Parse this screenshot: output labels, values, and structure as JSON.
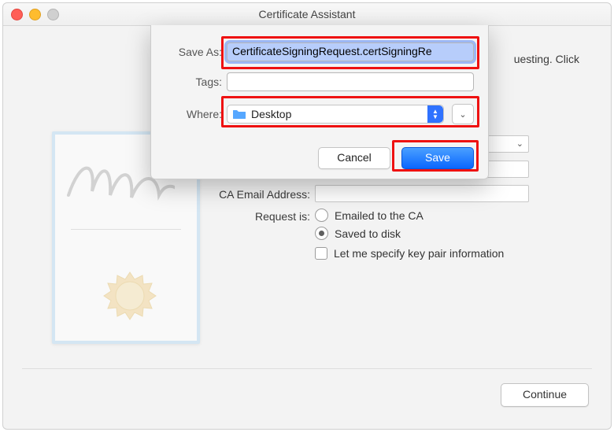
{
  "window": {
    "title": "Certificate Assistant"
  },
  "background": {
    "truncated_text": "uesting. Click",
    "ca_email_label": "CA Email Address:",
    "request_is_label": "Request is:",
    "radio_emailed": "Emailed to the CA",
    "radio_saved": "Saved to disk",
    "check_keypair": "Let me specify key pair information",
    "continue_label": "Continue"
  },
  "sheet": {
    "save_as_label": "Save As:",
    "save_as_value": "CertificateSigningRequest.certSigningRe",
    "tags_label": "Tags:",
    "tags_value": "",
    "where_label": "Where:",
    "where_value": "Desktop",
    "cancel_label": "Cancel",
    "save_label": "Save"
  }
}
